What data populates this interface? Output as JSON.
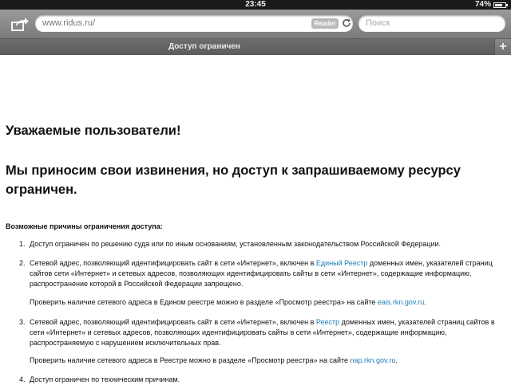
{
  "statusbar": {
    "time": "23:45",
    "battery": "74%",
    "battery_level": 0.74
  },
  "toolbar": {
    "share_icon": "share-icon",
    "url": "www.ridus.ru/",
    "reader_label": "Reader",
    "reload_icon": "reload-icon",
    "search_placeholder": "Поиск"
  },
  "tabs": {
    "title": "Доступ ограничен",
    "new_tab_label": "+"
  },
  "page": {
    "heading1": "Уважаемые пользователи!",
    "heading2": "Мы приносим свои извинения, но доступ к запрашиваемому ресурсу ограничен.",
    "reasons_title": "Возможные причины ограничения доступа:",
    "item1": {
      "num": "1.",
      "text": "Доступ ограничен  по решению суда или по иным основаниям, установленным законодательством Российской Федерации."
    },
    "item2": {
      "num": "2.",
      "pre": "Сетевой адрес, позволяющий идентифицировать сайт в сети «Интернет», включен в ",
      "link": "Единый Реестр",
      "post": " доменных имен, указателей страниц сайтов сети «Интернет» и сетевых адресов, позволяющих идентифицировать сайты в сети «Интернет», содержащие информацию, распространение которой в Российской Федерации запрещено.",
      "check_pre": "Проверить наличие сетевого адреса в Едином реестре можно в разделе «Просмотр реестра» на сайте ",
      "check_link": "eais.rkn.gov.ru",
      "check_post": "."
    },
    "item3": {
      "num": "3.",
      "pre": "Сетевой адрес, позволяющий идентифицировать сайт в сети «Интернет», включен в ",
      "link": "Реестр",
      "post": " доменных имен, указателей страниц сайтов в сети «Интернет» и сетевых адресов, позволяющих идентифицировать сайты в сети «Интернет», содержащие информацию, распространяемую с нарушением исключительных прав.",
      "check_pre": "Проверить наличие сетевого адреса в Реестре можно в разделе «Просмотр реестра» на сайте ",
      "check_link": "nap.rkn.gov.ru",
      "check_post": "."
    },
    "item4": {
      "num": "4.",
      "text": "Доступ ограничен по техническим причинам."
    }
  },
  "colors": {
    "link": "#1a7fb8",
    "toolbar": "#8a8a8a"
  }
}
